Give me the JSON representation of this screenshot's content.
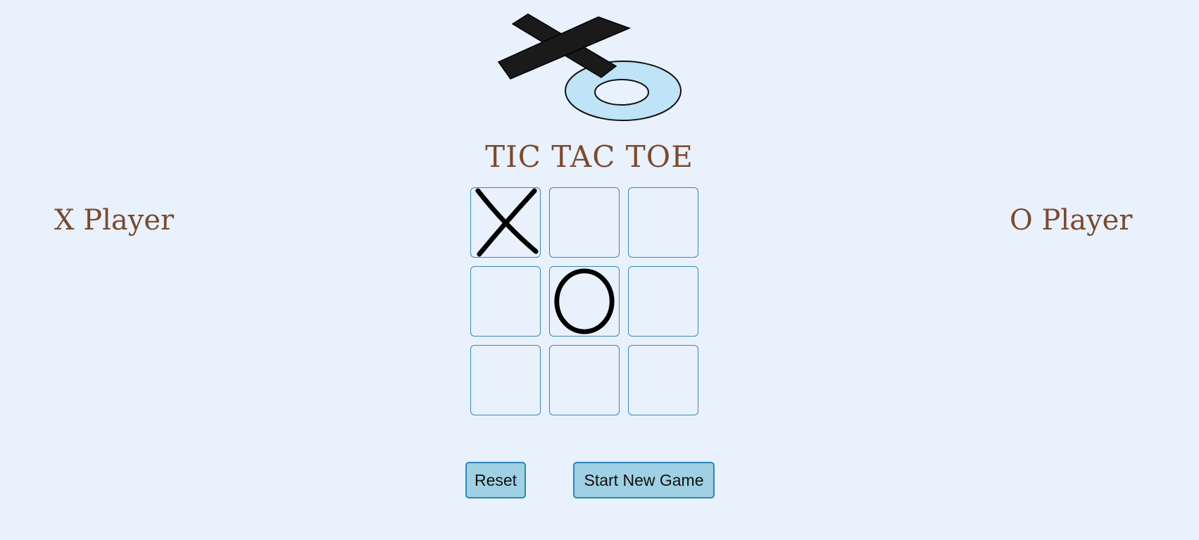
{
  "title": "TIC TAC TOE",
  "players": {
    "x_label": "X Player",
    "o_label": "O Player"
  },
  "board": {
    "cells": [
      "X",
      "",
      "",
      "",
      "O",
      "",
      "",
      "",
      ""
    ]
  },
  "buttons": {
    "reset": "Reset",
    "new_game": "Start New Game"
  },
  "colors": {
    "background": "#e9f1fc",
    "title": "#7a4a2e",
    "cell_border": "#3a87b8",
    "button_bg": "#9fd0e3",
    "button_border": "#2a86bf",
    "logo_o_fill": "#bfe3f7"
  },
  "icons": {
    "logo": "xo-logo-icon"
  }
}
